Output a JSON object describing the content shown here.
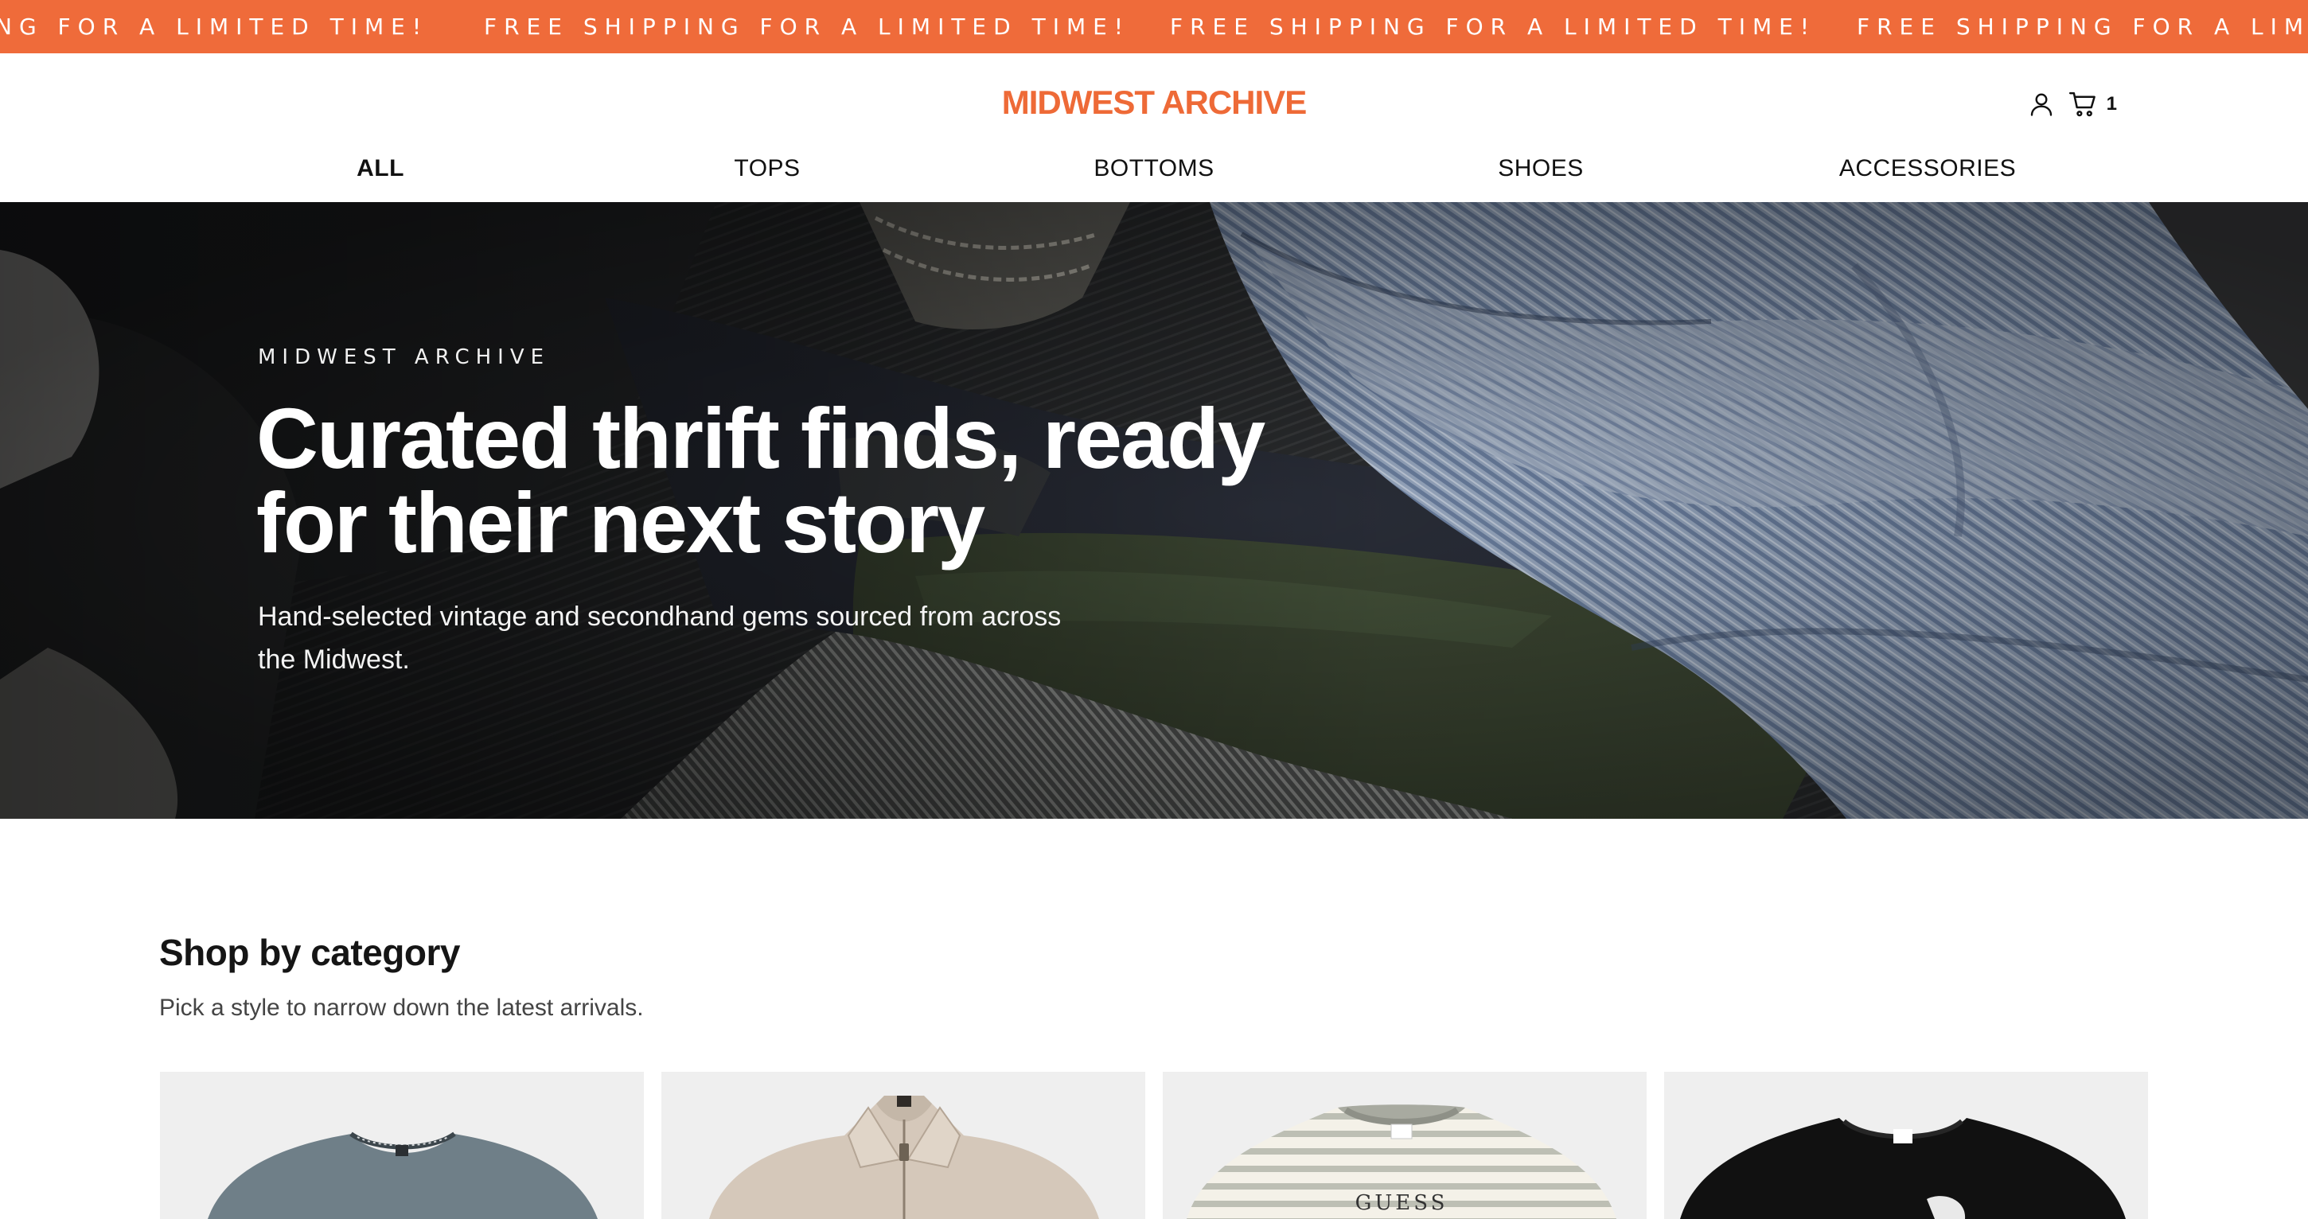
{
  "announcement": {
    "text": "FREE SHIPPING FOR A LIMITED TIME!",
    "fragment_start": "NG FOR A LIMITED TIME!",
    "fragment_end": "FREE SHIPPING FOR A LIMIT",
    "background": "#ef6b3a"
  },
  "header": {
    "logo": "MIDWEST ARCHIVE",
    "brand_color": "#ee6a37",
    "account_icon": "user-icon",
    "cart_icon": "cart-icon",
    "cart_count": "1"
  },
  "nav": {
    "items": [
      {
        "label": "ALL",
        "active": true
      },
      {
        "label": "TOPS",
        "active": false
      },
      {
        "label": "BOTTOMS",
        "active": false
      },
      {
        "label": "SHOES",
        "active": false
      },
      {
        "label": "ACCESSORIES",
        "active": false
      }
    ]
  },
  "hero": {
    "eyebrow": "MIDWEST ARCHIVE",
    "title": "Curated thrift finds, ready for their next story",
    "subtitle": "Hand-selected vintage and secondhand gems sourced from across the Midwest."
  },
  "categories": {
    "title": "Shop by category",
    "subtitle": "Pick a style to narrow down the latest arrivals.",
    "cards": [
      {
        "image": "gray-crewneck-sweater"
      },
      {
        "image": "beige-zip-polo"
      },
      {
        "image": "striped-guess-tee",
        "print": "GUESS"
      },
      {
        "image": "black-graphic-tee"
      }
    ]
  }
}
